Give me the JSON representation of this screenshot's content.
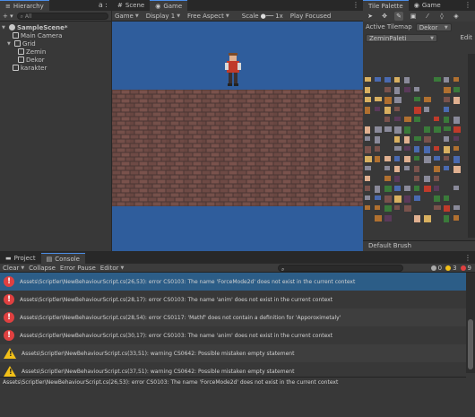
{
  "hierarchy": {
    "tab_label": "Hierarchy",
    "lock_badge": "a :",
    "add_label": "+ ▾",
    "search_placeholder": "All",
    "items": [
      {
        "label": "SampleScene*",
        "level": 0
      },
      {
        "label": "Main Camera",
        "level": 1
      },
      {
        "label": "Grid",
        "level": 1
      },
      {
        "label": "Zemin",
        "level": 2
      },
      {
        "label": "Dekor",
        "level": 2
      },
      {
        "label": "karakter",
        "level": 1
      }
    ]
  },
  "game": {
    "tabs": [
      "Scene",
      "Game"
    ],
    "toolbar": {
      "mode": "Game",
      "display": "Display 1",
      "aspect": "Free Aspect",
      "scale_label": "Scale",
      "scale_value": "1x",
      "play_mode": "Play Focused"
    },
    "colors": {
      "sky": "#2f5d9c",
      "brick": "#6e4a45",
      "mortar": "#4a3634"
    }
  },
  "palette": {
    "tabs": [
      "Tile Palette",
      "Game"
    ],
    "tools": [
      "select-icon",
      "move-icon",
      "paint-icon",
      "box-fill-icon",
      "pick-icon",
      "erase-icon",
      "fill-icon"
    ],
    "active_tilemap_label": "Active Tilemap",
    "active_tilemap_value": "Dekor",
    "palette_name": "ZeminPaleti",
    "edit_label": "Edit",
    "brush_label": "Default Brush"
  },
  "console": {
    "tabs": [
      "Project",
      "Console"
    ],
    "toolbar": [
      "Clear",
      "Collapse",
      "Error Pause",
      "Editor"
    ],
    "counts": {
      "info": "0",
      "warnings": "3",
      "errors": "9"
    },
    "logs": [
      {
        "type": "error",
        "text": "Assets\\Scriptler\\NewBehaviourScript.cs(26,53): error CS0103: The name 'ForceMode2d' does not exist in the current context"
      },
      {
        "type": "error",
        "text": "Assets\\Scriptler\\NewBehaviourScript.cs(28,17): error CS0103: The name 'anim' does not exist in the current context"
      },
      {
        "type": "error",
        "text": "Assets\\Scriptler\\NewBehaviourScript.cs(28,54): error CS0117: 'Mathf' does not contain a definition for 'Apporoximetaly'"
      },
      {
        "type": "error",
        "text": "Assets\\Scriptler\\NewBehaviourScript.cs(30,17): error CS0103: The name 'anim' does not exist in the current context"
      },
      {
        "type": "warning",
        "text": "Assets\\Scriptler\\NewBehaviourScript.cs(33,51): warning CS0642: Possible mistaken empty statement"
      },
      {
        "type": "warning",
        "text": "Assets\\Scriptler\\NewBehaviourScript.cs(37,51): warning CS0642: Possible mistaken empty statement"
      }
    ],
    "detail": "Assets\\Scriptler\\NewBehaviourScript.cs(26,53): error CS0103: The name 'ForceMode2d' does not exist in the current context"
  }
}
